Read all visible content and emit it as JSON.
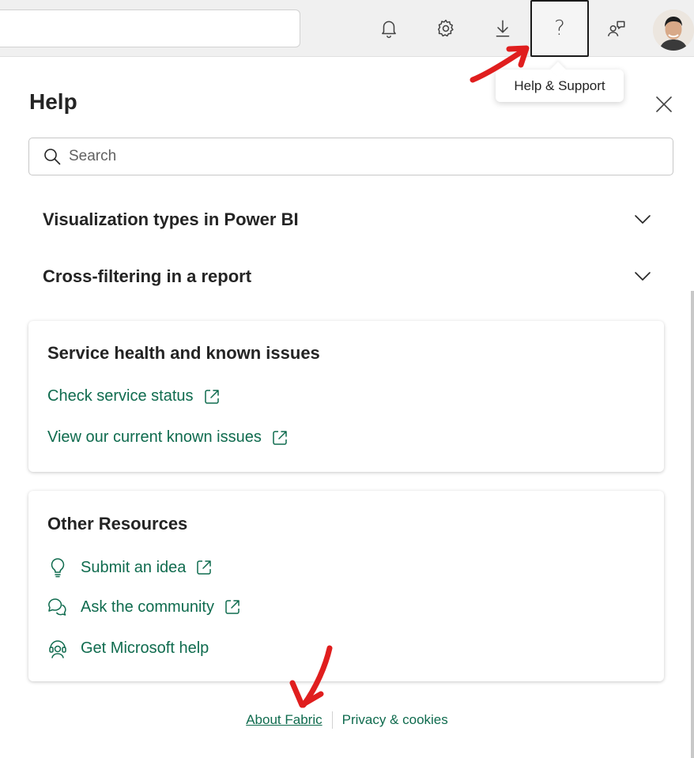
{
  "topbar": {
    "search_value": "",
    "icons": [
      "bell-icon",
      "gear-icon",
      "download-icon",
      "help-icon",
      "share-feedback-icon"
    ],
    "help_glyph": "?"
  },
  "tooltip": {
    "text": "Help & Support"
  },
  "panel": {
    "title": "Help",
    "search": {
      "placeholder": "Search",
      "value": ""
    },
    "accordions": [
      {
        "label": "Visualization types in Power BI"
      },
      {
        "label": "Cross-filtering in a report"
      }
    ],
    "service_health": {
      "title": "Service health and known issues",
      "links": [
        {
          "label": "Check service status"
        },
        {
          "label": "View our current known issues"
        }
      ]
    },
    "other_resources": {
      "title": "Other Resources",
      "links": [
        {
          "label": "Submit an idea",
          "icon": "lightbulb-icon"
        },
        {
          "label": "Ask the community",
          "icon": "chat-bubbles-icon"
        },
        {
          "label": "Get Microsoft help",
          "icon": "headset-icon"
        }
      ]
    },
    "footer": {
      "about": "About Fabric",
      "privacy": "Privacy & cookies"
    }
  },
  "colors": {
    "link": "#0f6b4e",
    "annotation": "#e01e1e",
    "topbar_bg": "#f0f0f0"
  }
}
